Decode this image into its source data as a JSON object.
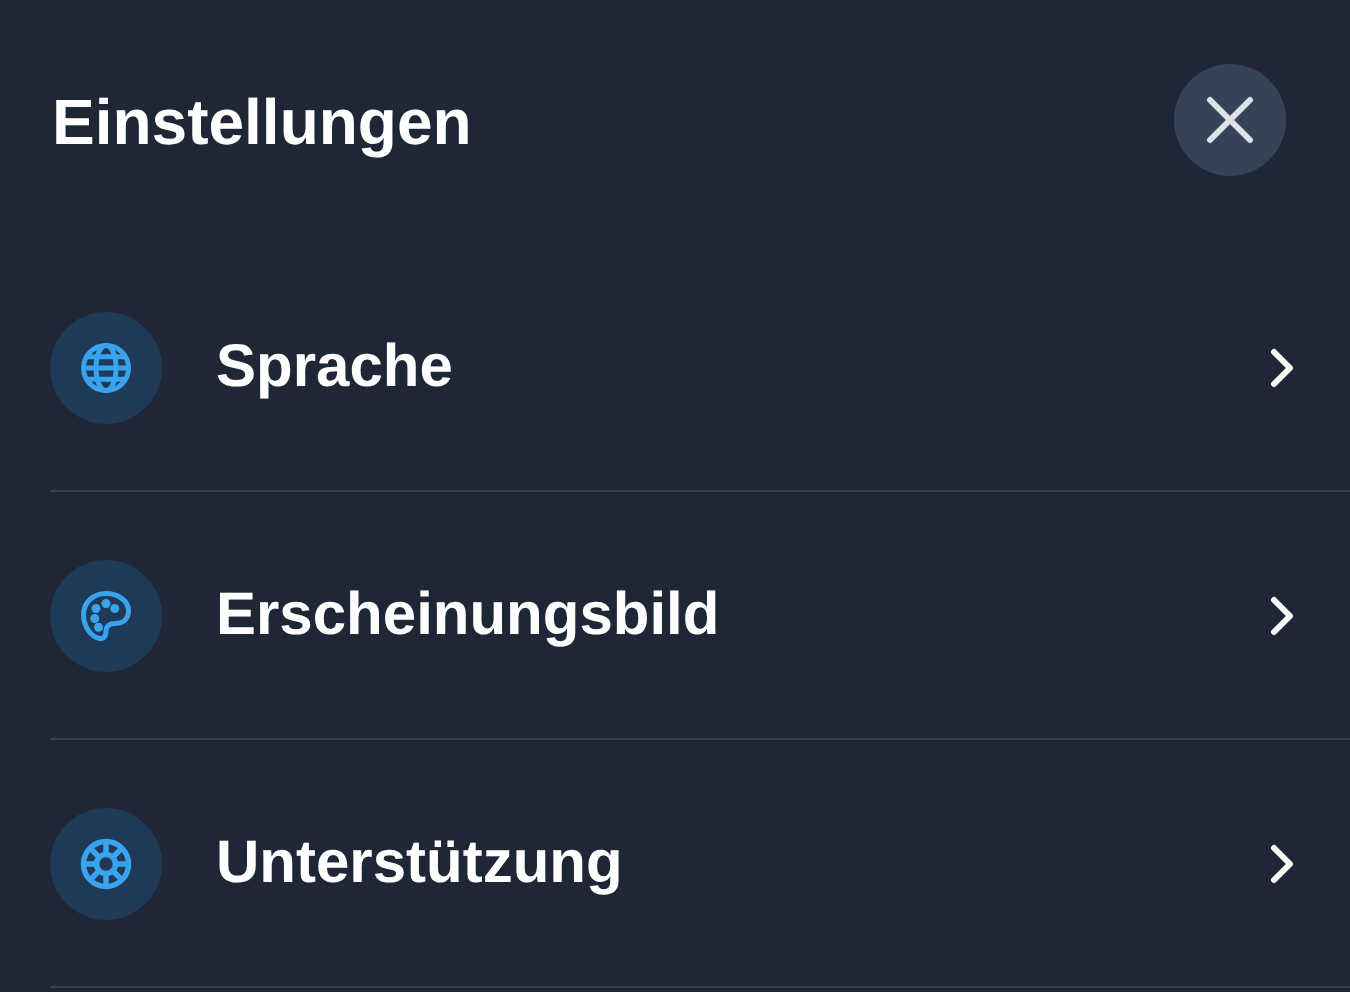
{
  "header": {
    "title": "Einstellungen"
  },
  "items": [
    {
      "label": "Sprache"
    },
    {
      "label": "Erscheinungsbild"
    },
    {
      "label": "Unterstützung"
    }
  ]
}
